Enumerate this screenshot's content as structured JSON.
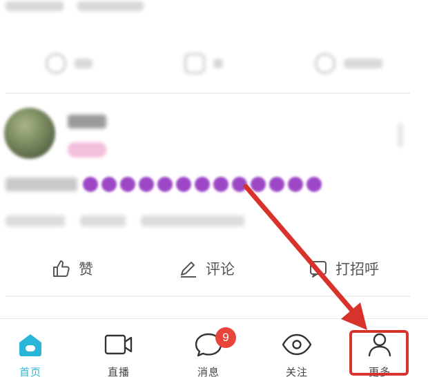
{
  "feed": {
    "action_like_label": "赞",
    "action_comment_label": "评论",
    "action_greet_label": "打招呼",
    "purple_dot_count": 13
  },
  "tabbar": {
    "items": [
      {
        "label": "首页",
        "icon": "home-icon",
        "active": true
      },
      {
        "label": "直播",
        "icon": "video-camera-icon",
        "active": false
      },
      {
        "label": "消息",
        "icon": "chat-bubble-icon",
        "active": false,
        "badge": "9"
      },
      {
        "label": "关注",
        "icon": "eye-icon",
        "active": false
      },
      {
        "label": "更多",
        "icon": "person-icon",
        "active": false
      }
    ]
  },
  "colors": {
    "accent_active": "#2ab6d8",
    "badge_red": "#e8443b",
    "annotation_red": "#d8322c",
    "blur_purple": "#9d47c7"
  }
}
